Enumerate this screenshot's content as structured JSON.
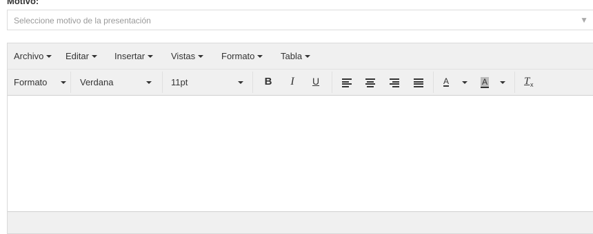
{
  "field": {
    "label": "Motivo:",
    "placeholder": "Seleccione motivo de la presentación",
    "arrow_icon": "▼"
  },
  "menubar": {
    "items": [
      {
        "label": "Archivo"
      },
      {
        "label": "Editar"
      },
      {
        "label": "Insertar"
      },
      {
        "label": "Vistas"
      },
      {
        "label": "Formato"
      },
      {
        "label": "Tabla"
      }
    ]
  },
  "toolbar": {
    "format_label": "Formato",
    "font_family": "Verdana",
    "font_size": "11pt",
    "bold": "B",
    "italic": "I",
    "underline": "U",
    "text_color": "A",
    "background_color": "A",
    "clear_formatting": "T",
    "clear_formatting_sub": "x"
  },
  "editor": {
    "content": ""
  }
}
